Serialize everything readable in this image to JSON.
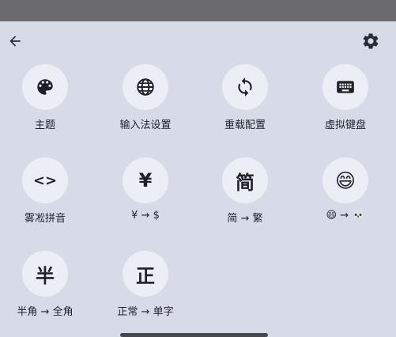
{
  "toolbar": {
    "back_icon": "arrow-left-icon",
    "settings_icon": "gear-icon"
  },
  "tiles": [
    {
      "icon": "palette-icon",
      "label": "主题"
    },
    {
      "icon": "globe-icon",
      "label": "输入法设置"
    },
    {
      "icon": "sync-icon",
      "label": "重载配置"
    },
    {
      "icon": "keyboard-icon",
      "label": "虚拟键盘"
    },
    {
      "glyph": "<>",
      "label": "雾凇拼音"
    },
    {
      "glyph": "¥",
      "label": "¥ → $"
    },
    {
      "glyph": "简",
      "label": "简 → 繁"
    },
    {
      "glyph": "😄",
      "label": "😄 → 💀"
    },
    {
      "glyph": "半",
      "label": "半角 → 全角"
    },
    {
      "glyph": "正",
      "label": "正常 → 单字"
    }
  ]
}
